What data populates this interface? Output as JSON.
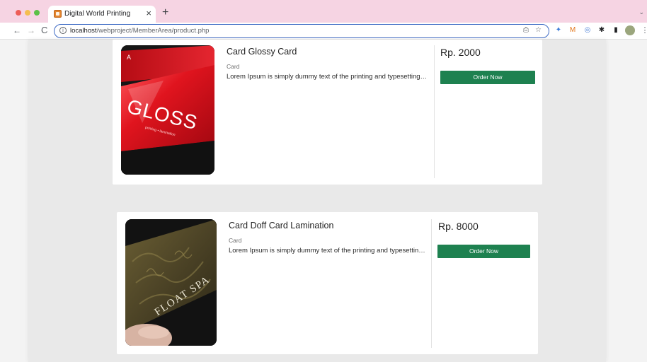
{
  "browser": {
    "tab_title": "Digital World Printing",
    "tab_close": "×",
    "new_tab": "+",
    "tab_menu": "⌄",
    "nav_back": "←",
    "nav_forward": "→",
    "nav_reload": "C",
    "url_host": "localhost",
    "url_path": "/webproject/MemberArea/product.php",
    "info_icon": "i",
    "share_icon": "⎙",
    "star_icon": "☆",
    "extensions": {
      "pin": "✦",
      "fox": "M",
      "lens": "◎",
      "puzzle": "✱",
      "side": "▮",
      "more": "⋮"
    }
  },
  "products": [
    {
      "title": "Card Glossy Card",
      "category": "Card",
      "description": "Lorem Ipsum is simply dummy text of the printing and typesetting industry.",
      "price": "Rp. 2000",
      "order_label": "Order Now",
      "image_text": "GLOSS",
      "image_subtext": "printing • lamination",
      "image_corner": "A"
    },
    {
      "title": "Card Doff Card Lamination",
      "category": "Card",
      "description": "Lorem Ipsum is simply dummy text of the printing and typesetting industry.",
      "price": "Rp. 8000",
      "order_label": "Order Now",
      "image_text": "FLOAT SPA"
    }
  ],
  "colors": {
    "tabbar": "#f6d4e3",
    "order_button": "#1e8150",
    "omnibox_border": "#3d6ac4",
    "gloss_red": "#d8121c"
  }
}
